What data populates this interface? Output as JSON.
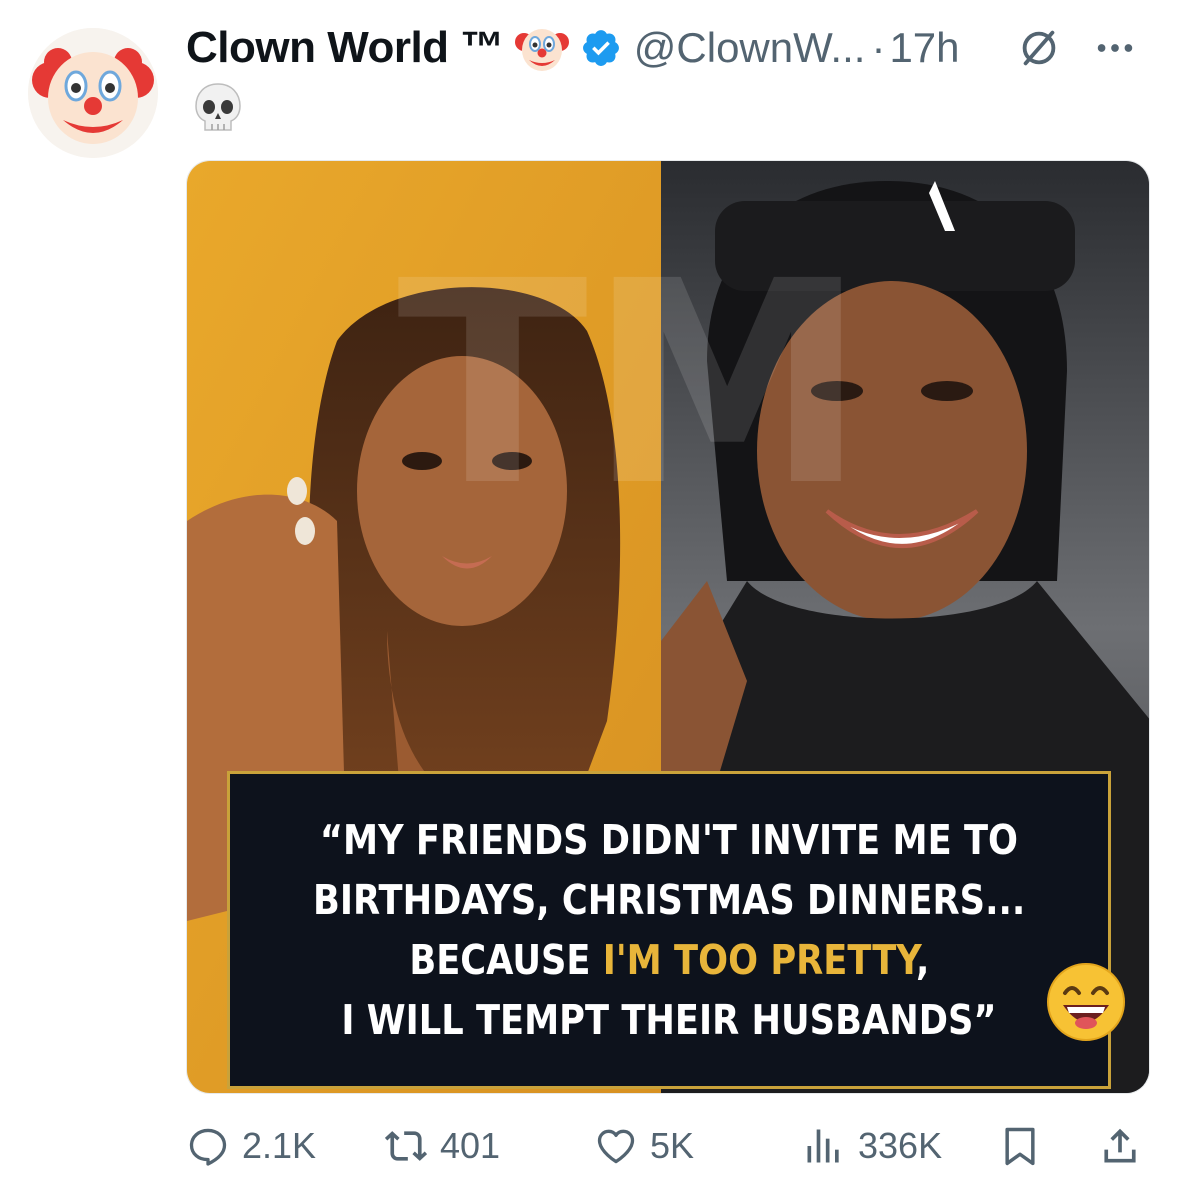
{
  "author": {
    "display_name": "Clown World ™",
    "handle": "@ClownW...",
    "separator": "·",
    "time": "17h",
    "avatar_icon": "clown-face-emoji",
    "name_emoji": "clown-face-emoji",
    "verified": true,
    "verified_color": "#1d9bf0"
  },
  "tweet": {
    "text_emoji": "skull-emoji"
  },
  "media": {
    "caption_lines": [
      {
        "parts": [
          {
            "text": "“MY FRIENDS DIDN'T INVITE ME TO",
            "highlight": false
          }
        ]
      },
      {
        "parts": [
          {
            "text": "BIRTHDAYS, CHRISTMAS DINNERS...",
            "highlight": false
          }
        ]
      },
      {
        "parts": [
          {
            "text": "BECAUSE ",
            "highlight": false
          },
          {
            "text": "I'M TOO PRETTY",
            "highlight": true
          },
          {
            "text": ",",
            "highlight": false
          }
        ]
      },
      {
        "parts": [
          {
            "text": "I WILL TEMPT THEIR HUSBANDS”",
            "highlight": false
          }
        ]
      }
    ],
    "caption_emoji": "grinning-squinting-face-emoji",
    "highlight_color": "#e8b53a",
    "caption_bg": "#0d121c",
    "caption_border": "#c9a23a"
  },
  "actions": {
    "replies": "2.1K",
    "reposts": "401",
    "likes": "5K",
    "views": "336K"
  }
}
